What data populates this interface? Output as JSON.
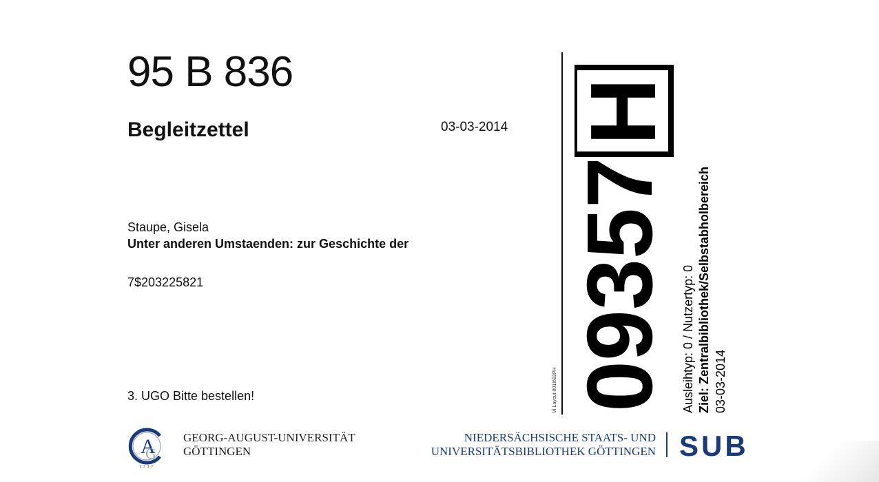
{
  "slip": {
    "signature": "95 B 836",
    "heading": "Begleitzettel",
    "date": "03-03-2014",
    "author": "Staupe, Gisela",
    "title": "Unter anderen Umstaenden: zur Geschichte der",
    "barcode_number": "7$203225821",
    "note": "3. UGO Bitte bestellen!"
  },
  "side": {
    "layout_code": "VI Layout 001I693PH",
    "big_number": "09357",
    "boxed_letter": "H",
    "loan_info": "Ausleihtyp: 0 / Nutzertyp: 0",
    "destination": "Ziel: Zentralbibliothek/Selbstabholbereich",
    "date": "03-03-2014"
  },
  "footer": {
    "gau_line1": "GEORG-AUGUST-UNIVERSITÄT",
    "gau_line2": "GÖTTINGEN",
    "gau_logo_year": "1737",
    "sub_line1": "NIEDERSÄCHSISCHE STAATS- UND",
    "sub_line2": "UNIVERSITÄTSBIBLIOTHEK GÖTTINGEN",
    "sub_logo": "SUB"
  },
  "colors": {
    "sub_blue": "#1b3a78",
    "gau_blue": "#1b3a78"
  }
}
